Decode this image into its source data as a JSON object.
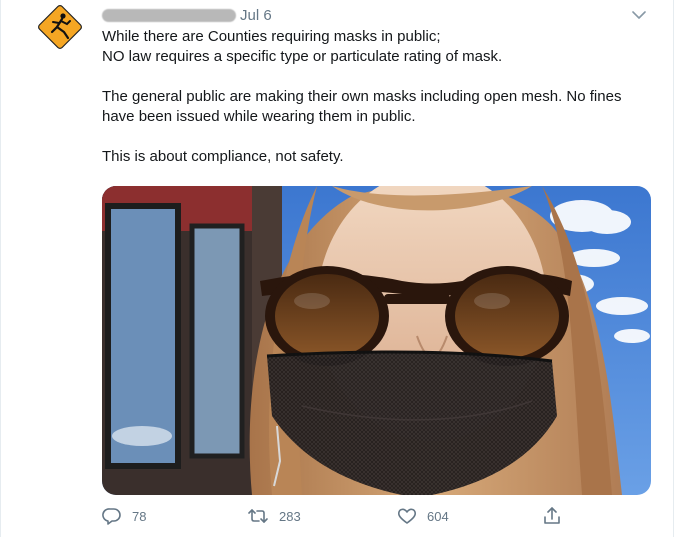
{
  "tweet": {
    "date": "Jul 6",
    "paragraphs": [
      "While there are Counties requiring masks in public;\nNO law requires a specific type or particulate rating of mask.",
      "The general public are making their own masks including open mesh.  No fines have been issued while wearing them in public.",
      "This is about compliance, not safety."
    ]
  },
  "actions": {
    "reply_count": "78",
    "retweet_count": "283",
    "like_count": "604"
  },
  "icons": {
    "avatar": "pedestrian-warning-sign",
    "menu": "chevron-down-icon",
    "reply": "reply-icon",
    "retweet": "retweet-icon",
    "like": "heart-icon",
    "share": "share-icon"
  },
  "colors": {
    "secondary_text": "#657786",
    "avatar_sign": "#f5a623"
  }
}
